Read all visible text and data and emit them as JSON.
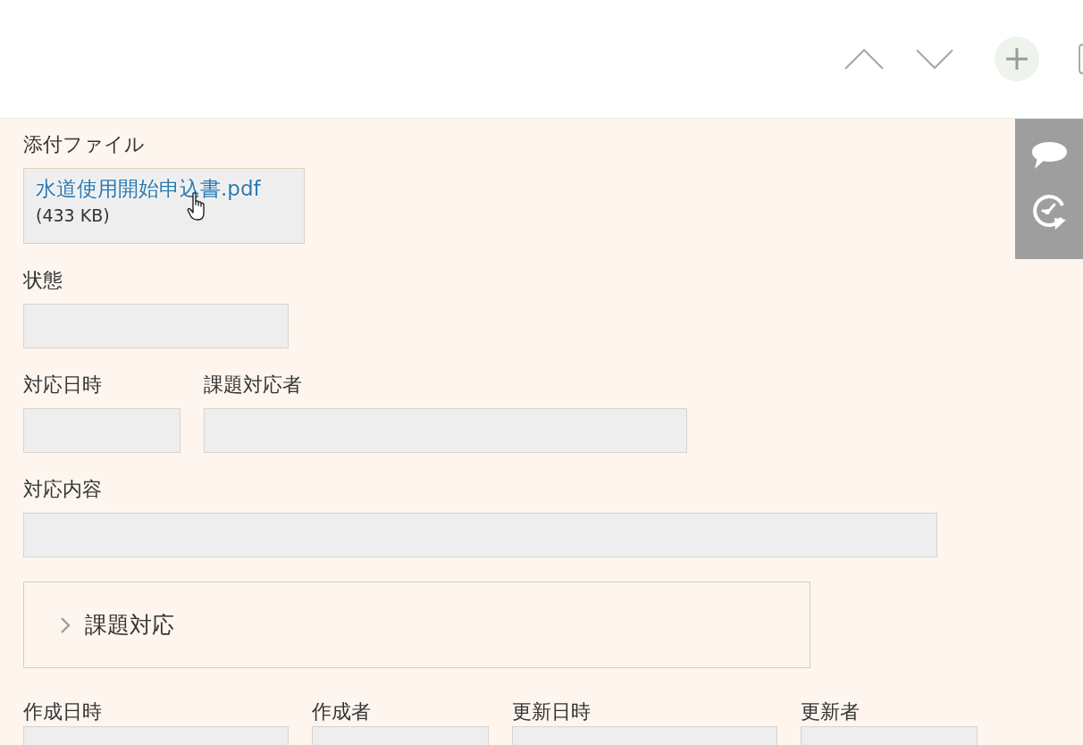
{
  "attachments": {
    "label": "添付ファイル",
    "files": [
      {
        "name": "水道使用開始申込書.pdf",
        "size": "(433 KB)",
        "hovered": true
      }
    ]
  },
  "field_rows": [
    [
      {
        "label": "状態",
        "kind": "status"
      }
    ],
    [
      {
        "label": "対応日時",
        "kind": "date"
      },
      {
        "label": "課題対応者",
        "kind": "user"
      }
    ],
    [
      {
        "label": "対応内容",
        "kind": "text"
      }
    ]
  ],
  "group": {
    "label": "課題対応",
    "expanded": false
  },
  "footer_rows": [
    [
      {
        "label": "作成日時",
        "kind": "datetime"
      },
      {
        "label": "作成者",
        "kind": "creator"
      },
      {
        "label": "更新日時",
        "kind": "datetime"
      },
      {
        "label": "更新者",
        "kind": "creator"
      }
    ]
  ]
}
